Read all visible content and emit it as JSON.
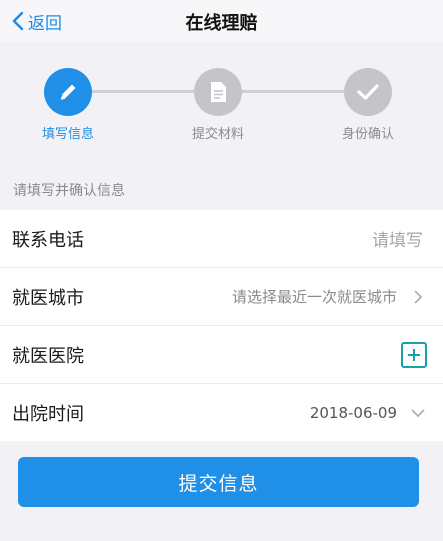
{
  "navbar": {
    "back_label": "返回",
    "title": "在线理赔"
  },
  "steps": [
    {
      "label": "填写信息",
      "icon": "pencil-icon",
      "active": true
    },
    {
      "label": "提交材料",
      "icon": "document-icon",
      "active": false
    },
    {
      "label": "身份确认",
      "icon": "check-icon",
      "active": false
    }
  ],
  "form": {
    "hint": "请填写并确认信息",
    "phone": {
      "label": "联系电话",
      "placeholder": "请填写"
    },
    "city": {
      "label": "就医城市",
      "placeholder": "请选择最近一次就医城市"
    },
    "hospital": {
      "label": "就医医院"
    },
    "discharge": {
      "label": "出院时间",
      "value": "2018-06-09"
    }
  },
  "submit_label": "提交信息",
  "colors": {
    "accent": "#1f8fe8",
    "step_inactive": "#c4c4c9",
    "teal": "#1aa0a8"
  }
}
